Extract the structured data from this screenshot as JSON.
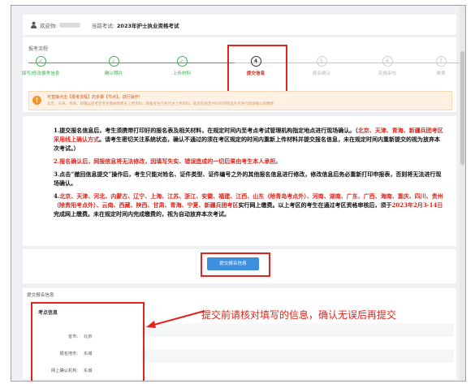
{
  "header": {
    "welcome": "欢迎你:",
    "exam_label": "当前考试:",
    "exam_name": "2023年护士执业资格考试"
  },
  "progress": {
    "title": "报考流程",
    "steps": [
      {
        "num": "✓",
        "label": "填写/修改报考信息",
        "state": "done"
      },
      {
        "num": "✓",
        "label": "确认照片",
        "state": "done"
      },
      {
        "num": "✓",
        "label": "上传材料",
        "state": "done"
      },
      {
        "num": "4",
        "label": "提交信息",
        "state": "current"
      },
      {
        "num": "5",
        "label": "报名确认",
        "state": "todo"
      },
      {
        "num": "6",
        "label": "资格审核",
        "state": "todo"
      },
      {
        "num": "7",
        "label": "缴费",
        "state": "todo"
      }
    ],
    "notice_line1": "可直接点击【报考流程】的步骤【节点】，进行操作!",
    "notice_line2": "北京、天津、青海、新疆兵团考区考生缴纳网费未上传资料，网报考生在各元注上传资料，能后在规定时间内到所选考点进行现场确认及缴费"
  },
  "instructions": {
    "p1_a": "1.提交报名信息后，考生须携带打印好的报名表及相关材料，在规定时间内至考点考试管理机构指定地点进行现场确认。（",
    "p1_red": "北京、天津、青海、新疆兵团考区采用线上确认方式",
    "p1_b": "。请考生密切关注系统状态，确认不通过的须在考区规定的时间内重新上传材料并提交报名信息，未在规定时间内重新提交的视为放弃本次考试。）",
    "p2": "2.报名确认后，网报信息将无法修改，因填写失实、错误造成的一切后果由考生本人承担。",
    "p3": "3.点击“撤回信息提交”操作后，考生只能对姓名、证件类型、证件编号之外的其他报名信息进行修改，修改信息后务必重新打印申报表，否则将无法进行现场确认。",
    "p4_a": "4.",
    "p4_red": "北京、天津、河北、内蒙古、辽宁、上海、江苏、浙江、安徽、福建、江西、山东（除青岛考点外）、河南、湖南、广东、广西、海南、重庆、四川、贵州（除贵阳考点外）、云南、西藏、陕西、甘肃、青海、宁夏、新疆兵团考区",
    "p4_b": "实行网上缴费。以上考区的考生在通过考区资格审核后，须于",
    "p4_date": "2023年2月3-14日",
    "p4_c": "完成网上缴费。未在规定时间内完成缴费的，视为自动放弃本次考试。"
  },
  "submit": {
    "button_label": "提交报名信息"
  },
  "info": {
    "section_title": "提交报名信息",
    "box_title": "考点信息",
    "rows": [
      {
        "key": "省市:",
        "value": "北京"
      },
      {
        "key": "报名地市:",
        "value": "东城"
      },
      {
        "key": "网上确认机构:",
        "value": "东城"
      }
    ],
    "callout": "提交前请核对填写的信息，确认无误后再提交"
  },
  "colors": {
    "accent": "#3f8fe0",
    "done": "#35b84a",
    "highlight": "#e0261c"
  }
}
